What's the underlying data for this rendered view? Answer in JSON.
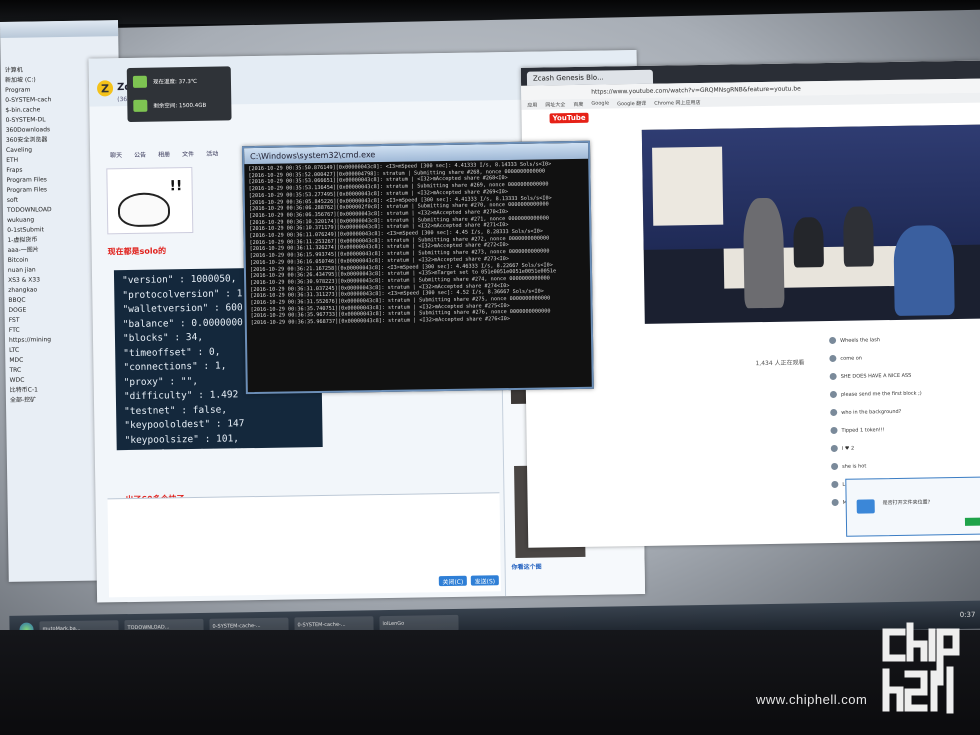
{
  "watermark": {
    "site": "www.chiphell.com",
    "logo_text": "chip hell"
  },
  "notification": {
    "line1": "现在温度: 37.3℃",
    "line2": "剩余空间: 1500.4GB"
  },
  "qq_window": {
    "title": "Zcash",
    "subtitle": "(3661人群) 群聊",
    "tools": [
      "聊天",
      "公告",
      "相册",
      "文件",
      "活动"
    ],
    "msg_solo": "现在都是solo的",
    "msg_blocks": "出了60多个块了",
    "msg_look": "你看这个图",
    "json_lines": [
      "\"version\" : 1000050,",
      "\"protocolversion\" : 1",
      "\"walletversion\" : 600",
      "\"balance\" : 0.0000000",
      "\"blocks\" : 34,",
      "\"timeoffset\" : 0,",
      "\"connections\" : 1,",
      "\"proxy\" : \"\",",
      "\"difficulty\" : 1.492",
      "\"testnet\" : false,",
      "\"keypoololdest\" : 147",
      "\"keypoolsize\" : 101,",
      "\"paytxfee\" : 0.00000000,",
      "\"relayfee\" : 0.00005000,",
      "\"errors\" : \"\""
    ],
    "send_button": "发送(S)",
    "close_button": "关闭(C)"
  },
  "cmd_window": {
    "title": "C:\\Windows\\system32\\cmd.exe",
    "lines": [
      "[2016-10-29 00:35:50.876149][0x00000043c8]: <I3>mSpeed [300 sec]: 4.41333 I/s, 8.14333 Sols/s<I0>",
      "[2016-10-29 00:35:52.000427][0x000004798]: stratum | Submitting share #268, nonce 0000000000000",
      "[2016-10-29 00:35:53.066651][0x00000043c8]: stratum | <I32>mAccepted share #268<I0>",
      "[2016-10-29 00:35:53.136454][0x00000043c8]: stratum | Submitting share #269, nonce 0000000000000",
      "[2016-10-29 00:35:53.277495][0x00000043c8]: stratum | <I32>mAccepted share #269<I0>",
      "[2016-10-29 00:36:05.845226][0x00000043c8]: <I3>mSpeed [300 sec]: 4.41333 I/s, 8.13333 Sols/s<I0>",
      "[2016-10-29 00:36:06.288762][0x000002f0c8]: stratum | Submitting share #270, nonce 0000000000000",
      "[2016-10-29 00:36:06.356767][0x00000043c8]: stratum | <I32>mAccepted share #270<I0>",
      "[2016-10-29 00:36:10.320174][0x00000043c8]: stratum | Submitting share #271, nonce 0000000000000",
      "[2016-10-29 00:36:10.371179][0x00000043c8]: stratum | <I32>mAccepted share #271<I0>",
      "[2016-10-29 00:36:11.076249][0x00000043c8]: <I3>mSpeed [300 sec]: 4.45 I/s, 8.28333 Sols/s<I0>",
      "[2016-10-29 00:36:11.253267][0x00000043c8]: stratum | Submitting share #272, nonce 0000000000000",
      "[2016-10-29 00:36:11.326274][0x00000043c8]: stratum | <I32>mAccepted share #272<I0>",
      "[2016-10-29 00:36:15.993745][0x00000043c8]: stratum | Submitting share #273, nonce 0000000000000",
      "[2016-10-29 00:36:16.050746][0x00000043c8]: stratum | <I32>mAccepted share #273<I0>",
      "[2016-10-29 00:36:21.167258][0x00000043c8]: <I3>mSpeed [300 sec]: 4.46333 I/s, 8.22667 Sols/s<I0>",
      "[2016-10-29 00:36:26.434795][0x00000043c8]: stratum | <I35>mTarget set to 051e0051e0051e0051e0051e",
      "[2016-10-29 00:36:30.978223][0x00000043c8]: stratum | Submitting share #274, nonce 0000000000000",
      "[2016-10-29 00:36:31.037245][0x00000043c8]: stratum | <I32>mAccepted share #274<I0>",
      "[2016-10-29 00:36:31.311273][0x00000043c8]: <I3>mSpeed [300 sec]: 4.52 I/s, 8.36667 Sols/s<I0>",
      "[2016-10-29 00:36:31.552676][0x00000043c8]: stratum | Submitting share #275, nonce 0000000000000",
      "[2016-10-29 00:36:35.740751][0x00000043c8]: stratum | <I32>mAccepted share #275<I0>",
      "[2016-10-29 00:36:35.967733][0x00000043c8]: stratum | Submitting share #276, nonce 0000000000000",
      "[2016-10-29 00:36:35.968737][0x00000043c8]: stratum | <I32>mAccepted share #276<I0>"
    ]
  },
  "browser": {
    "tab_title": "Zcash Genesis Blo...",
    "url": "https://www.youtube.com/watch?v=GRQMNsgRNB&feature=youtu.be",
    "bookmarks": [
      "应用",
      "网址大全",
      "百度",
      "Google",
      "Google 翻译",
      "Chrome 网上应用店"
    ],
    "youtube_logo": "YouTube",
    "views": "1,434 人正在观看",
    "chat": [
      "Wheels the lash",
      "come on",
      "SHE DOES HAVE A NICE ASS",
      "please send me the first block ;)",
      "who in the background?",
      "Tipped 1 token!!!",
      "I ♥ 2",
      "she is hot",
      "Launch launch launch",
      "MasterTraderCom all day"
    ]
  },
  "explorer": {
    "items": [
      "计算机",
      "新加坡 (C:)",
      "Program",
      "0-SYSTEM-cach",
      "$-bin.cache",
      "0-SYSTEM-DL",
      "360Downloads",
      "360安全浏览器",
      "Caveling",
      "ETH",
      "Fraps",
      "Program Files",
      "Program Files",
      "soft",
      "TODOWNLOAD",
      "wukuang",
      "0-1stSubmit",
      "1-虚拟货币",
      "aaa-一图片",
      "Bitcoin",
      "nuan jian",
      "XS3 & X33",
      "zhangkao",
      "BBQC",
      "DOGE",
      "FST",
      "FTC",
      "https://mining",
      "LTC",
      "MDC",
      "TRC",
      "WDC",
      "比特币C-1",
      "全部-挖矿"
    ]
  },
  "taskbar": {
    "items": [
      "mutoMark.ba...",
      "TODOWNLOAD...",
      "0-SYSTEM-cache-...",
      "0-SYSTEM-cache-...",
      "lolLenGo"
    ],
    "time": "0:37"
  },
  "popup": {
    "text": "是否打开文件夹位置?"
  }
}
